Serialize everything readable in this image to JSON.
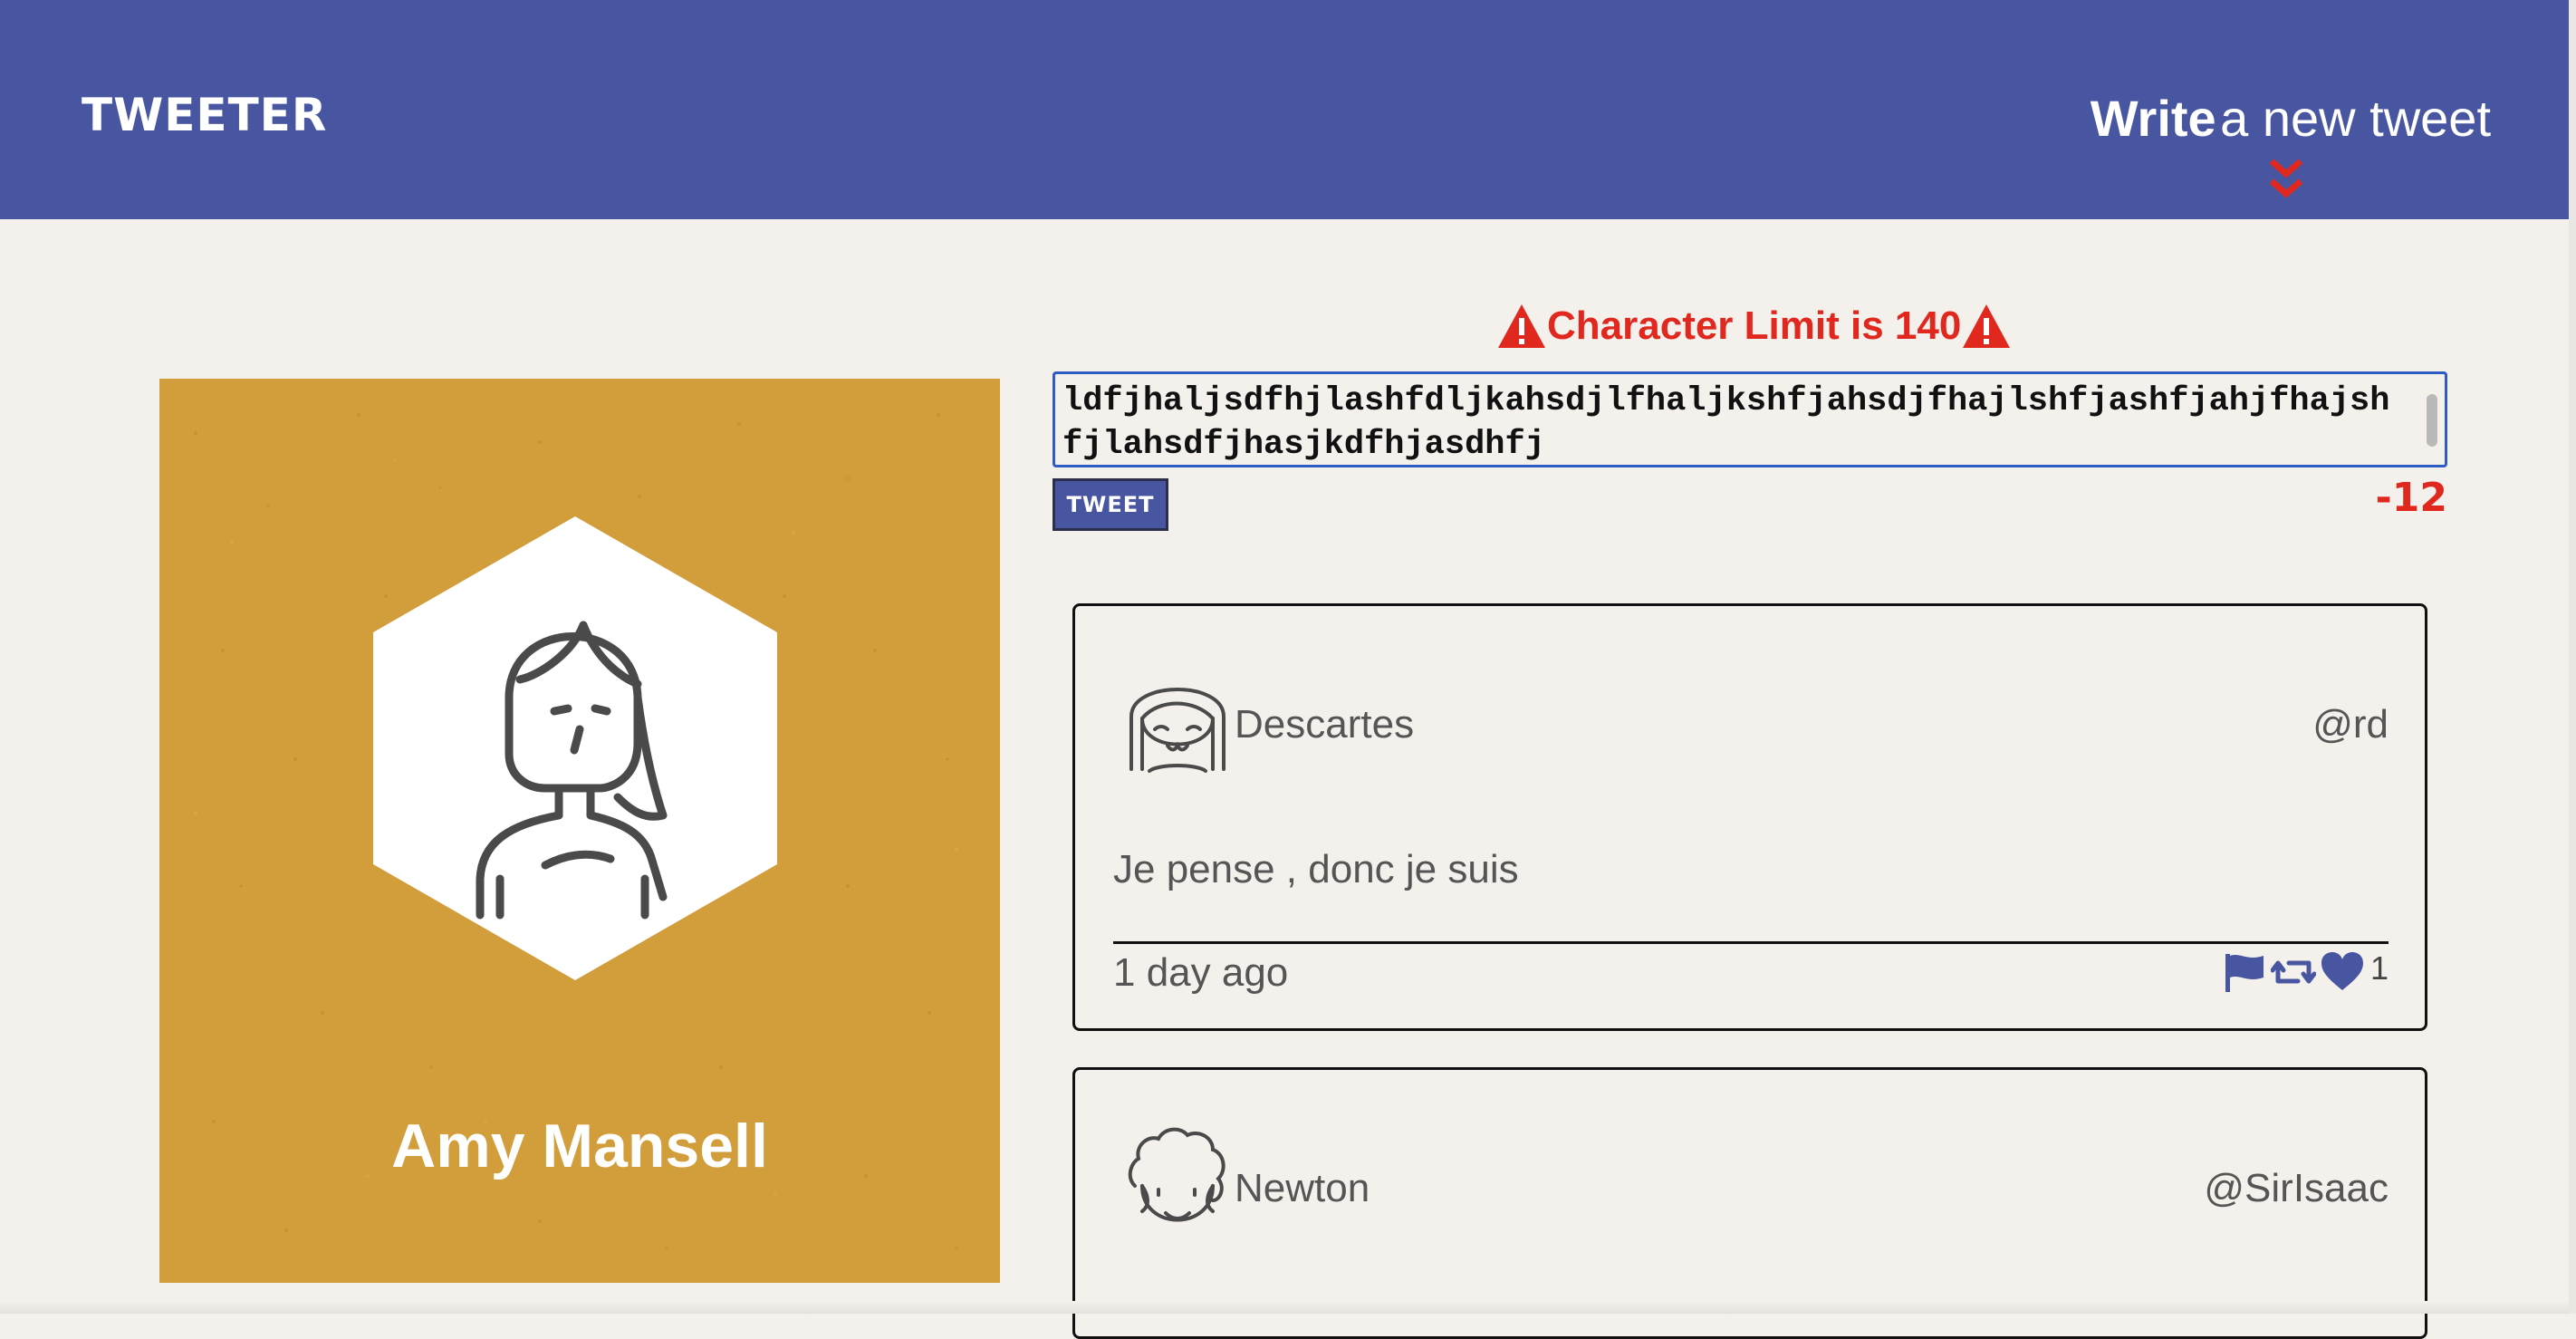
{
  "nav": {
    "brand": "TWEETER",
    "compose_toggle": {
      "bold": "Write",
      "rest": "a new tweet"
    },
    "chevron_icon": "double-chevron-down-icon",
    "accent_color": "#e0281f",
    "bar_color": "#4856a1"
  },
  "profile": {
    "name": "Amy Mansell",
    "avatar_icon": "woman-avatar-icon",
    "background_color": "#d29d3b"
  },
  "compose": {
    "error_message": "Character Limit is 140",
    "error_icon": "warning-icon",
    "textarea_value": "ldfjhaljsdfhjlashfdljkahsdjlfhaljkshfjahsdjfhajlshfjashfjahjfhajshfjlahsdfjhasjkdfhjasdhfj",
    "button_label": "TWEET",
    "counter": "-12"
  },
  "tweets": [
    {
      "name": "Descartes",
      "handle": "@rd",
      "text": "Je pense , donc je suis",
      "time": "1 day ago",
      "likes": "1",
      "avatar_icon": "smiling-face-avatar-icon",
      "action_icons": [
        "flag-icon",
        "retweet-icon",
        "heart-icon"
      ]
    },
    {
      "name": "Newton",
      "handle": "@SirIsaac",
      "avatar_icon": "curly-hair-avatar-icon"
    }
  ]
}
